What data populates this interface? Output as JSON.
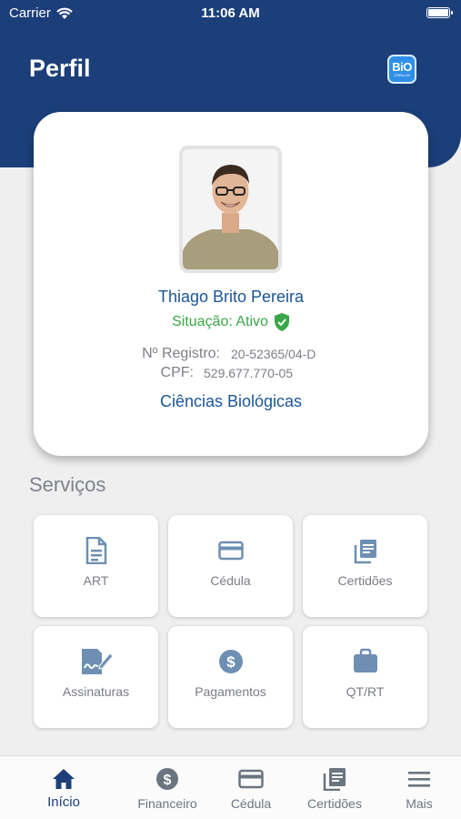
{
  "status_bar": {
    "carrier": "Carrier",
    "time": "11:06 AM"
  },
  "header": {
    "title": "Perfil",
    "logo_main": "BiO",
    "logo_sub": "CRBio-04"
  },
  "profile": {
    "name": "Thiago Brito Pereira",
    "status": "Situação: Ativo",
    "registration_label": "Nº Registro:",
    "registration_value": "20-52365/04-D",
    "cpf_label": "CPF:",
    "cpf_value": "529.677.770-05",
    "course": "Ciências Biológicas"
  },
  "services": {
    "title": "Serviços",
    "items": [
      {
        "label": "ART",
        "icon": "document-icon"
      },
      {
        "label": "Cédula",
        "icon": "card-icon"
      },
      {
        "label": "Certidões",
        "icon": "stacked-documents-icon"
      },
      {
        "label": "Assinaturas",
        "icon": "signature-icon"
      },
      {
        "label": "Pagamentos",
        "icon": "dollar-icon"
      },
      {
        "label": "QT/RT",
        "icon": "briefcase-icon"
      }
    ]
  },
  "tab_bar": {
    "items": [
      {
        "label": "Início",
        "icon": "home-icon",
        "active": true
      },
      {
        "label": "Financeiro",
        "icon": "dollar-icon"
      },
      {
        "label": "Cédula",
        "icon": "card-icon"
      },
      {
        "label": "Certidões",
        "icon": "stacked-documents-icon"
      },
      {
        "label": "Mais",
        "icon": "menu-icon"
      }
    ]
  },
  "colors": {
    "header": "#1c3f7a",
    "accent": "#1b5596",
    "status_active": "#3aa649",
    "icon": "#6e8fb3"
  }
}
